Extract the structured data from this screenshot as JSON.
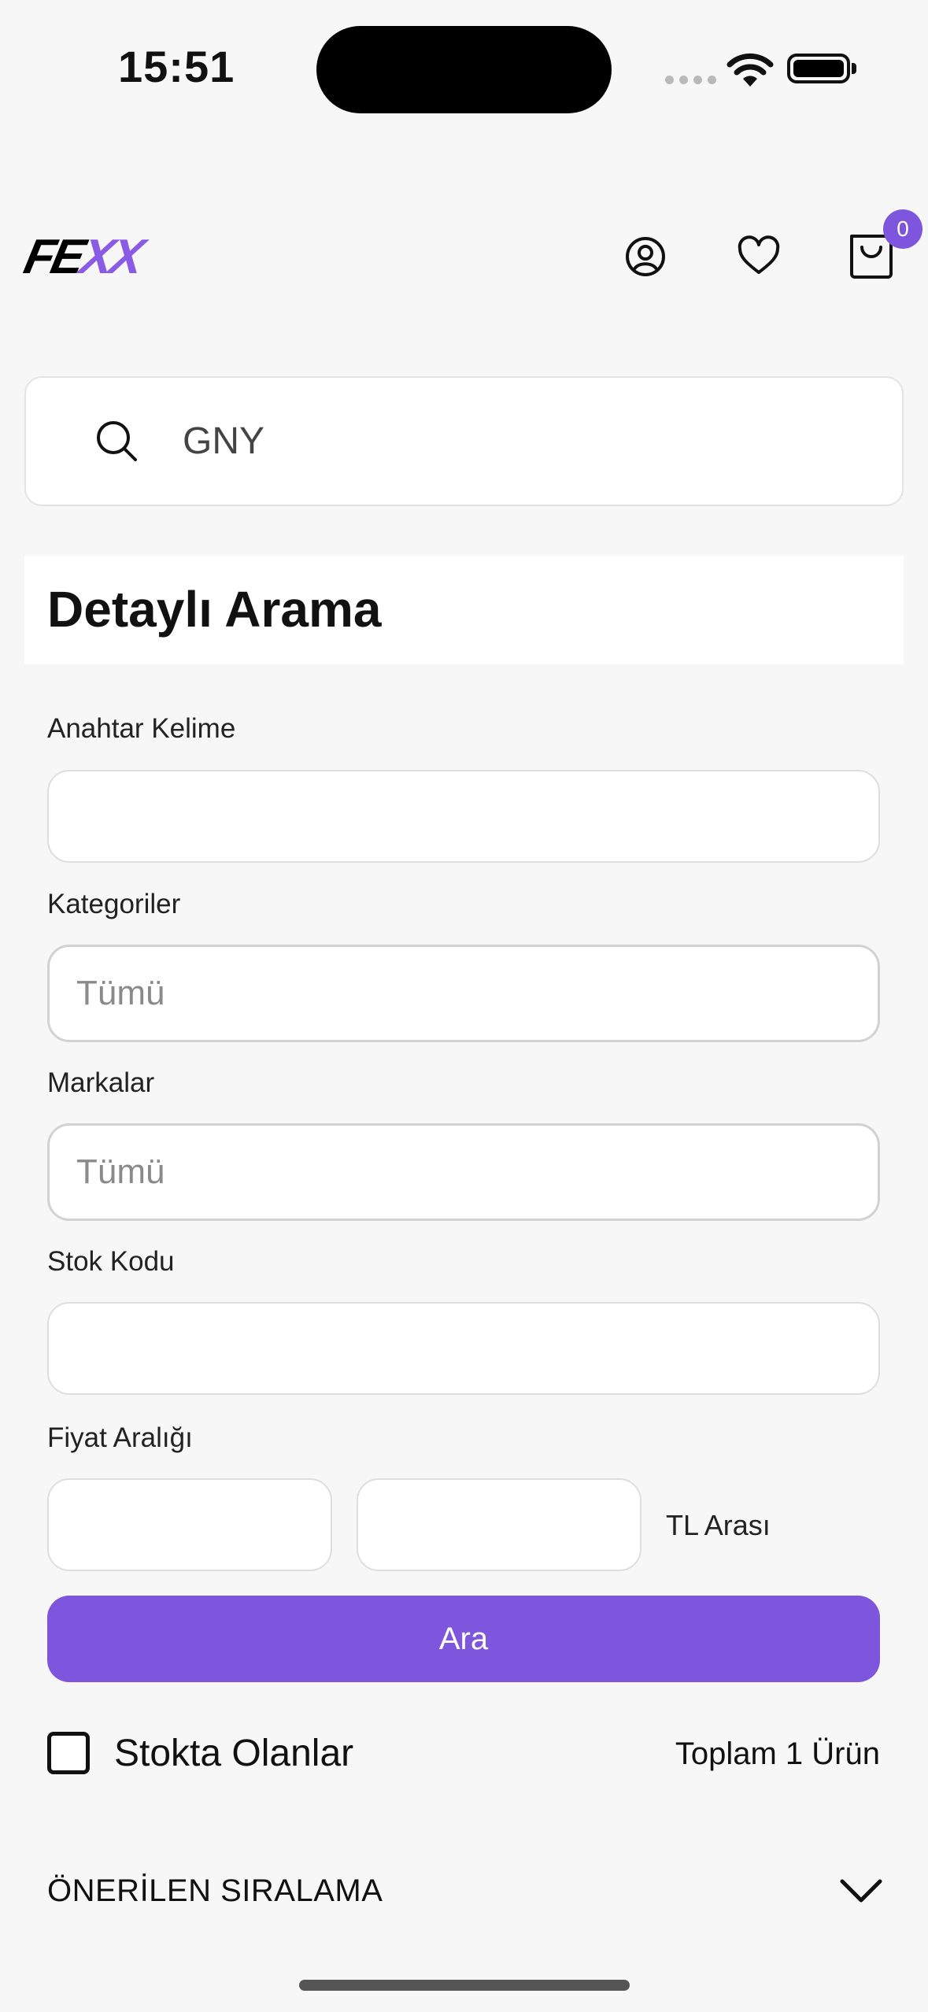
{
  "status_bar": {
    "time": "15:51"
  },
  "header": {
    "logo_part1": "FE",
    "logo_part2": "XX",
    "cart_count": "0"
  },
  "search": {
    "value": "GNY"
  },
  "detailed_search": {
    "title": "Detaylı Arama",
    "keyword_label": "Anahtar Kelime",
    "keyword_value": "",
    "categories_label": "Kategoriler",
    "categories_placeholder": "Tümü",
    "brands_label": "Markalar",
    "brands_placeholder": "Tümü",
    "stock_code_label": "Stok Kodu",
    "stock_code_value": "",
    "price_range_label": "Fiyat Aralığı",
    "price_min": "",
    "price_max": "",
    "price_suffix": "TL Arası",
    "search_button": "Ara"
  },
  "results": {
    "in_stock_label": "Stokta Olanlar",
    "in_stock_checked": false,
    "total_label": "Toplam 1 Ürün",
    "sort_label": "ÖNERİLEN SIRALAMA"
  },
  "colors": {
    "accent": "#7e55dd",
    "logo_accent": "#8a5be4"
  }
}
